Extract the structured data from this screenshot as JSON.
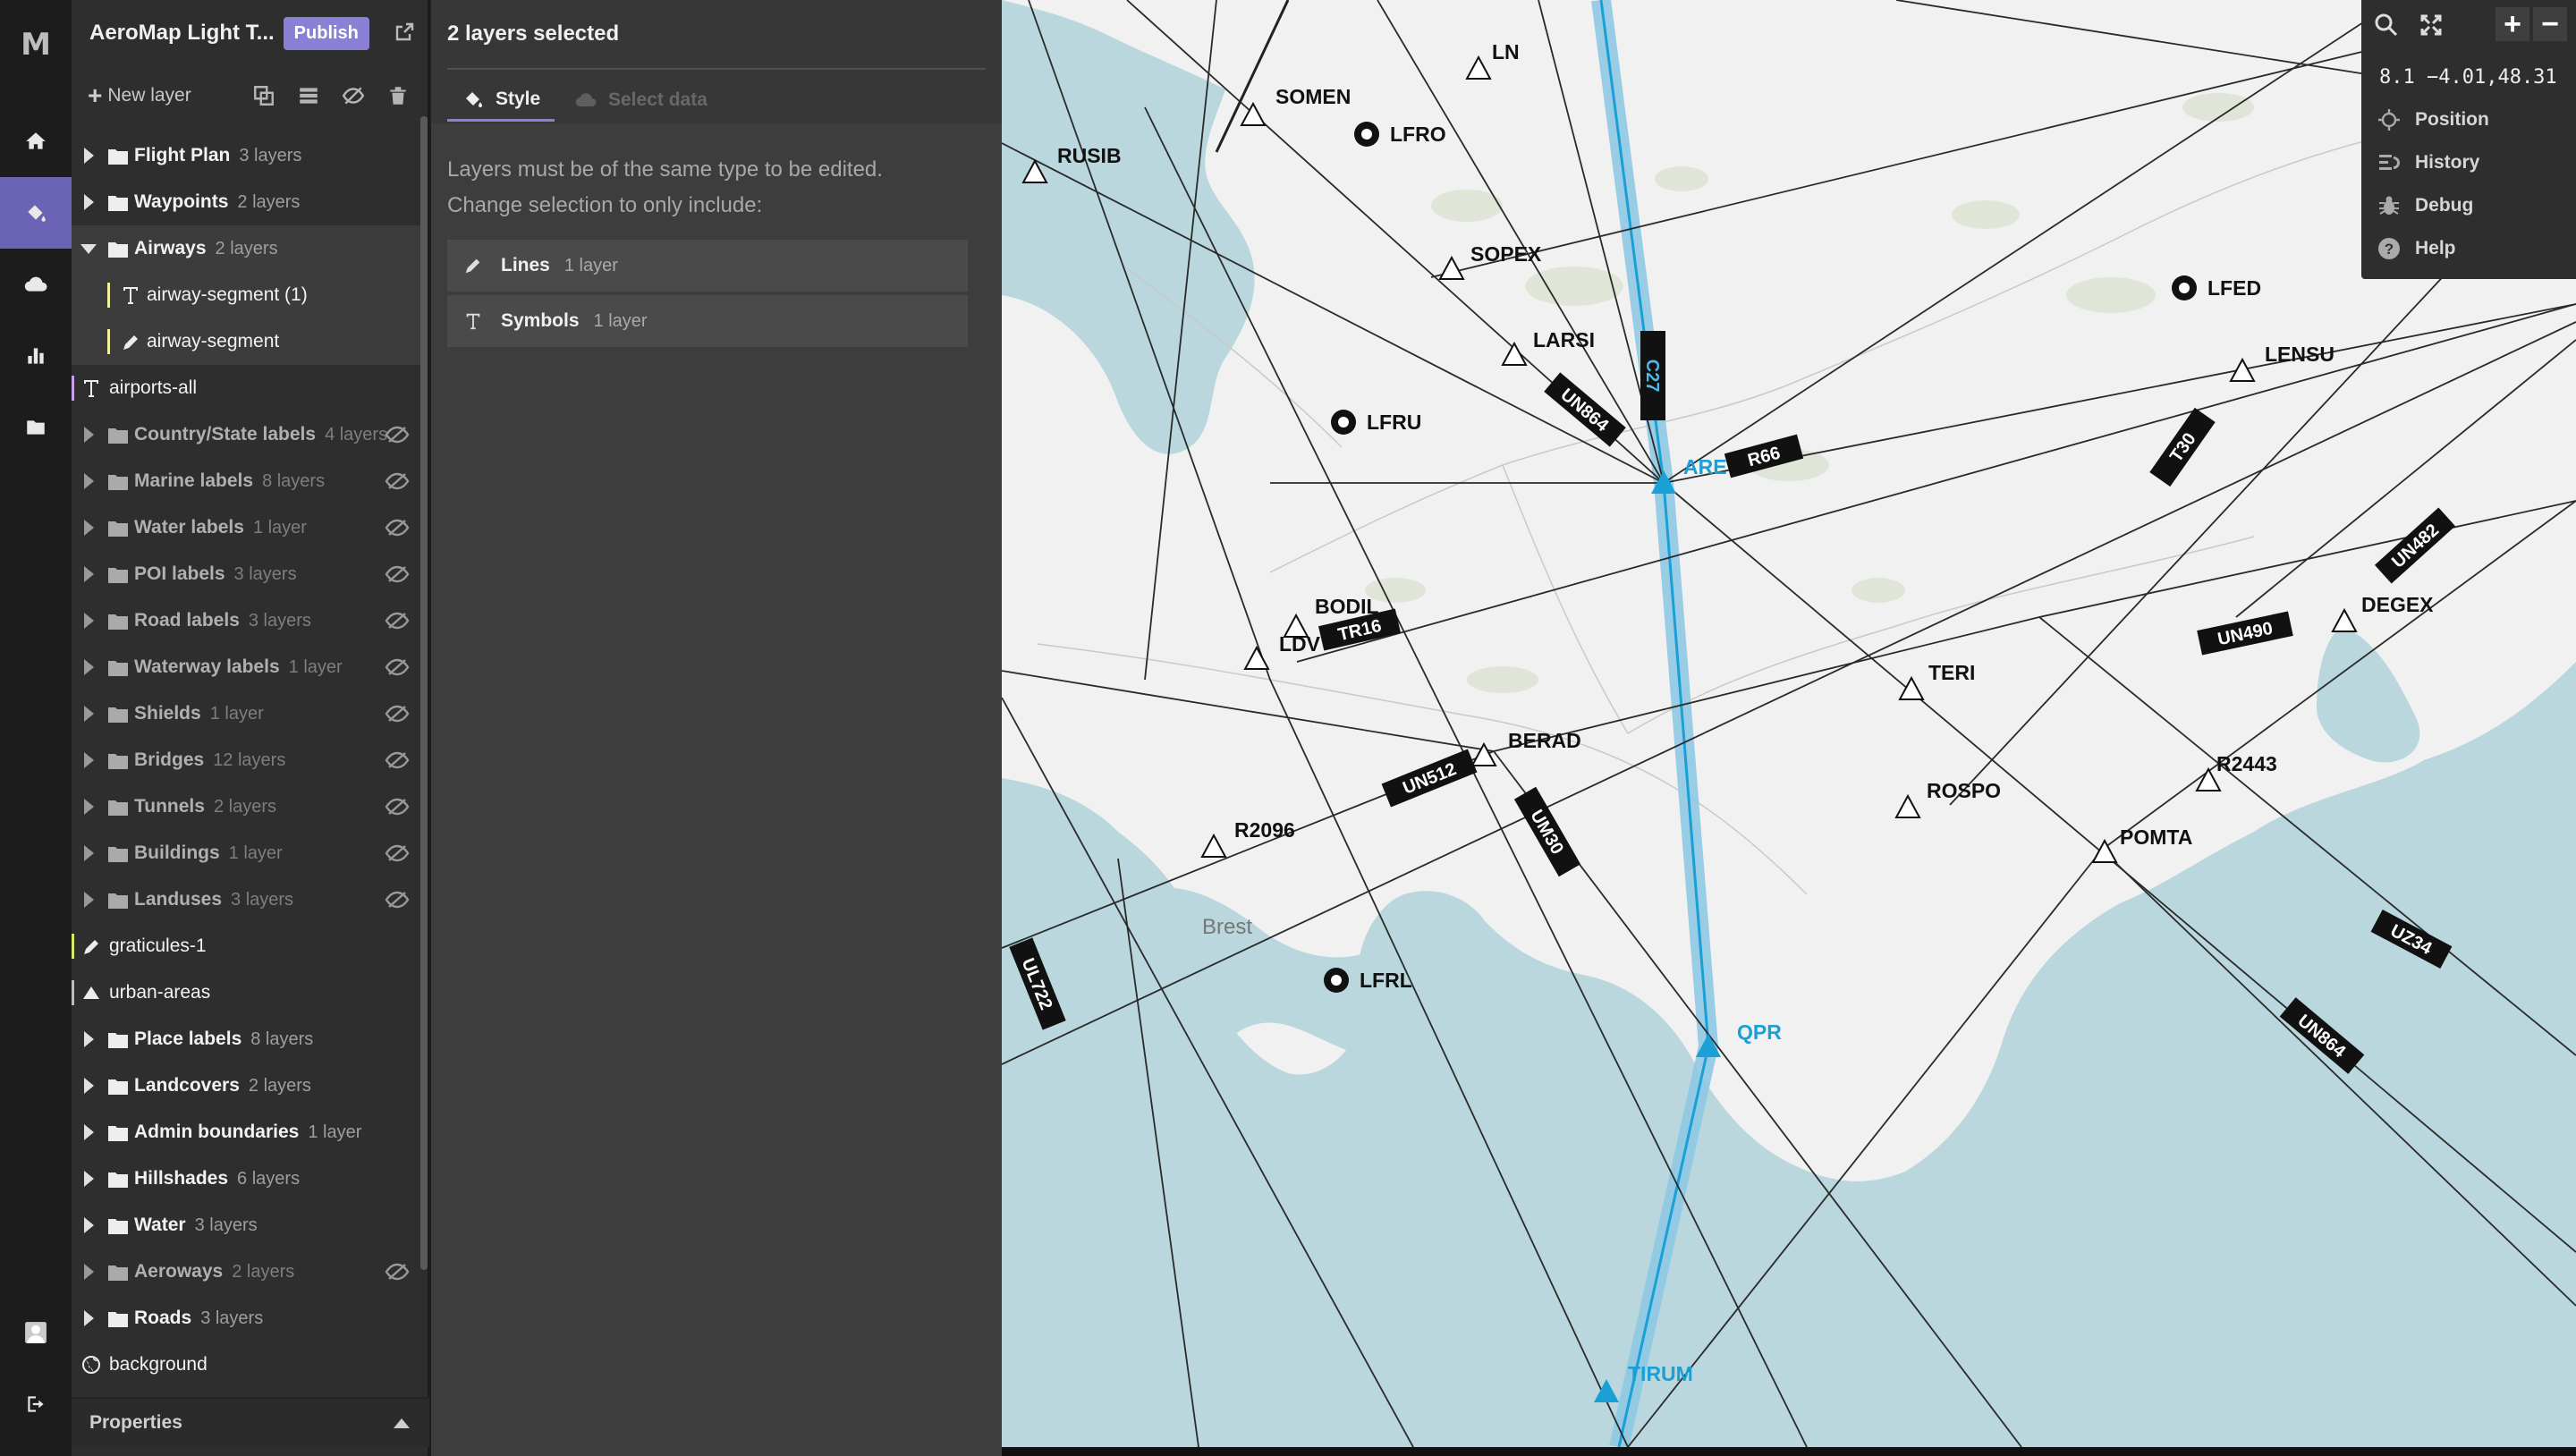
{
  "app": {
    "logo": "M"
  },
  "rail": {
    "items": [
      {
        "icon": "home-icon"
      },
      {
        "icon": "paint-bucket-icon",
        "active": true
      },
      {
        "icon": "cloud-icon"
      },
      {
        "icon": "bar-chart-icon"
      },
      {
        "icon": "folder-icon"
      }
    ],
    "bottom": [
      {
        "icon": "user-avatar-icon"
      },
      {
        "icon": "logout-icon"
      }
    ]
  },
  "project": {
    "title": "AeroMap Light T...",
    "publish_label": "Publish"
  },
  "toolbar": {
    "new_layer_label": "New layer"
  },
  "layers": [
    {
      "kind": "group",
      "name": "Flight Plan",
      "count": "3 layers"
    },
    {
      "kind": "group",
      "name": "Waypoints",
      "count": "2 layers"
    },
    {
      "kind": "group",
      "name": "Airways",
      "count": "2 layers",
      "open": true,
      "selected": true
    },
    {
      "kind": "child",
      "name": "airway-segment (1)",
      "type": "symbol",
      "selected": true,
      "color": "#f0f0a0"
    },
    {
      "kind": "child",
      "name": "airway-segment",
      "type": "line",
      "selected": true,
      "color": "#f0f0a0"
    },
    {
      "kind": "solo",
      "name": "airports-all",
      "type": "symbol",
      "color": "#c8a0e8"
    },
    {
      "kind": "group",
      "name": "Country/State labels",
      "count": "4 layers",
      "hidden": true
    },
    {
      "kind": "group",
      "name": "Marine labels",
      "count": "8 layers",
      "hidden": true
    },
    {
      "kind": "group",
      "name": "Water labels",
      "count": "1 layer",
      "hidden": true
    },
    {
      "kind": "group",
      "name": "POI labels",
      "count": "3 layers",
      "hidden": true
    },
    {
      "kind": "group",
      "name": "Road labels",
      "count": "3 layers",
      "hidden": true
    },
    {
      "kind": "group",
      "name": "Waterway labels",
      "count": "1 layer",
      "hidden": true
    },
    {
      "kind": "group",
      "name": "Shields",
      "count": "1 layer",
      "hidden": true
    },
    {
      "kind": "group",
      "name": "Bridges",
      "count": "12 layers",
      "hidden": true
    },
    {
      "kind": "group",
      "name": "Tunnels",
      "count": "2 layers",
      "hidden": true
    },
    {
      "kind": "group",
      "name": "Buildings",
      "count": "1 layer",
      "hidden": true
    },
    {
      "kind": "group",
      "name": "Landuses",
      "count": "3 layers",
      "hidden": true
    },
    {
      "kind": "solo",
      "name": "graticules-1",
      "type": "line",
      "color": "#d7e86a"
    },
    {
      "kind": "solo",
      "name": "urban-areas",
      "type": "fill",
      "color": "#bdbdbd"
    },
    {
      "kind": "group",
      "name": "Place labels",
      "count": "8 layers"
    },
    {
      "kind": "group",
      "name": "Landcovers",
      "count": "2 layers"
    },
    {
      "kind": "group",
      "name": "Admin boundaries",
      "count": "1 layer"
    },
    {
      "kind": "group",
      "name": "Hillshades",
      "count": "6 layers"
    },
    {
      "kind": "group",
      "name": "Water",
      "count": "3 layers"
    },
    {
      "kind": "group",
      "name": "Aeroways",
      "count": "2 layers",
      "hidden": true
    },
    {
      "kind": "group",
      "name": "Roads",
      "count": "3 layers"
    },
    {
      "kind": "solo",
      "name": "background",
      "type": "background",
      "color": "none"
    }
  ],
  "properties_label": "Properties",
  "editor": {
    "title": "2 layers selected",
    "tabs": {
      "style": "Style",
      "select_data": "Select data"
    },
    "message_1": "Layers must be of the same type to be edited.",
    "message_2": "Change selection to only include:",
    "options": [
      {
        "label": "Lines",
        "count": "1 layer",
        "icon": "pencil-icon"
      },
      {
        "label": "Symbols",
        "count": "1 layer",
        "icon": "text-t-icon"
      }
    ]
  },
  "map_controls": {
    "coords": "8.1 −4.01,48.31",
    "items": [
      "Position",
      "History",
      "Debug",
      "Help"
    ],
    "zoom_in": "+",
    "zoom_out": "−"
  },
  "map": {
    "colors": {
      "water": "#b9d7dc",
      "land": "#f1f1f1",
      "highlight": "#1a9fd6",
      "route_band": "#8ec9e3"
    },
    "waypoints": [
      "LN",
      "SOMEN",
      "RUSIB",
      "SOPEX",
      "LARSI",
      "BODIL",
      "LDV",
      "BERAD",
      "R2096",
      "TERI",
      "ROSPO",
      "R2443",
      "POMTA",
      "DEGEX",
      "LENSU"
    ],
    "airports": [
      "LFRO",
      "LFRU",
      "LFRL",
      "LFED"
    ],
    "route_points": [
      "ARE",
      "QPR",
      "TIRUM"
    ],
    "airways": [
      "C27",
      "UN864",
      "R66",
      "T30",
      "UN482",
      "UN490",
      "TR16",
      "UN512",
      "UM30",
      "UL722",
      "UZ34",
      "UN864"
    ],
    "place_labels": [
      "Brest"
    ]
  }
}
